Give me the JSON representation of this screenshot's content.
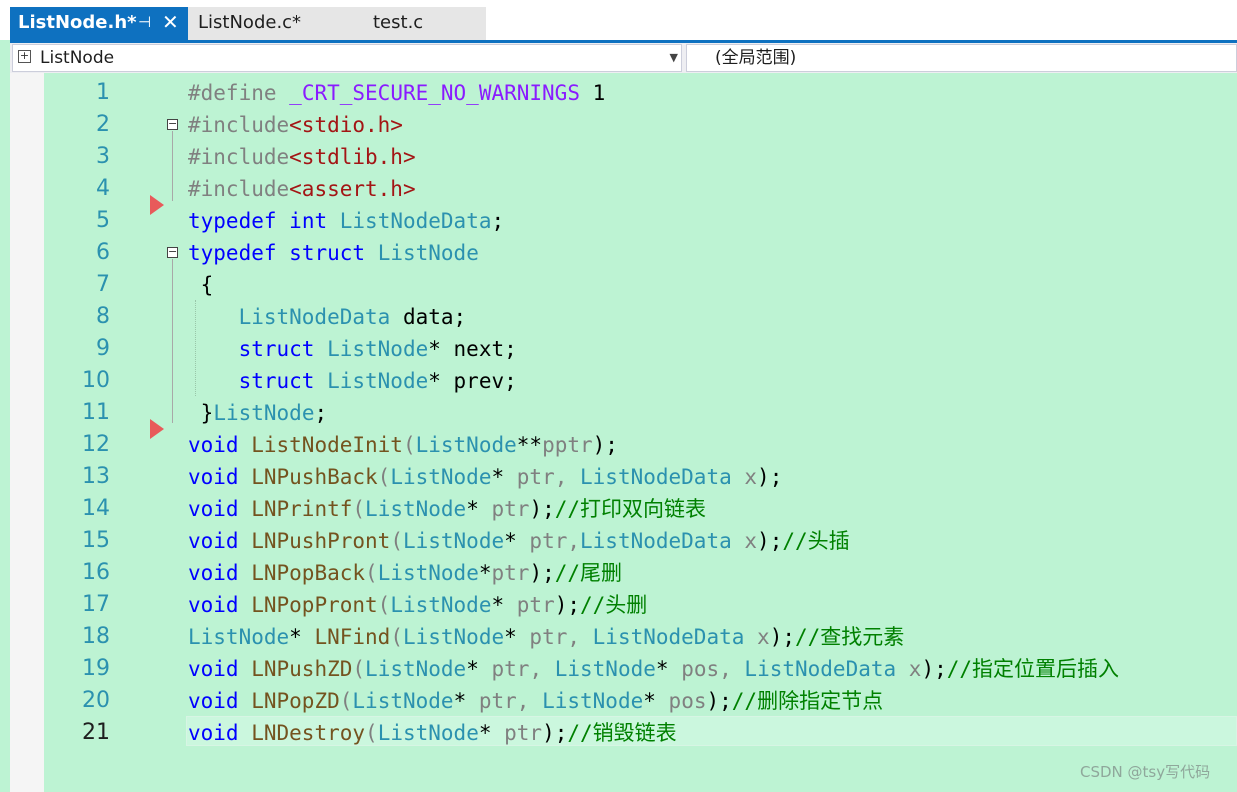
{
  "tabs": [
    {
      "name": "ListNode.h*",
      "active": true
    },
    {
      "name": "ListNode.c*",
      "active": false
    },
    {
      "name": "test.c",
      "active": false
    }
  ],
  "tab_icons": {
    "pin": "⊣",
    "close": "✕"
  },
  "navigation": {
    "class_scope": "ListNode",
    "member_scope": "(全局范围)"
  },
  "line_numbers": [
    "1",
    "2",
    "3",
    "4",
    "5",
    "6",
    "7",
    "8",
    "9",
    "10",
    "11",
    "12",
    "13",
    "14",
    "15",
    "16",
    "17",
    "18",
    "19",
    "20",
    "21"
  ],
  "current_line": 21,
  "code": {
    "l1": {
      "kw": "#define",
      "mac": "_CRT_SECURE_NO_WARNINGS",
      "num": "1"
    },
    "l2": {
      "kw": "#include",
      "str": "<stdio.h>"
    },
    "l3": {
      "kw": "#include",
      "str": "<stdlib.h>"
    },
    "l4": {
      "kw": "#include",
      "str": "<assert.h>"
    },
    "l5": {
      "kw": "typedef",
      "kw2": "int",
      "ty": "ListNodeData",
      "end": ";"
    },
    "l6": {
      "kw": "typedef",
      "kw2": "struct",
      "ty": "ListNode"
    },
    "l7": {
      "brace": "{"
    },
    "l8": {
      "ty": "ListNodeData",
      "name": "data;"
    },
    "l9": {
      "kw": "struct",
      "ty": "ListNode",
      "name": "* next;"
    },
    "l10": {
      "kw": "struct",
      "ty": "ListNode",
      "name": "* prev;"
    },
    "l11": {
      "brace": "}",
      "ty": "ListNode",
      "end": ";"
    },
    "l12": {
      "kw": "void",
      "fn": "ListNodeInit",
      "t1": "ListNode",
      "star": "**",
      "p1": "pptr",
      "end": ");"
    },
    "l13": {
      "kw": "void",
      "fn": "LNPushBack",
      "t1": "ListNode",
      "p1": "ptr",
      "t2": "ListNodeData",
      "p2": "x",
      "end": ");"
    },
    "l14": {
      "kw": "void",
      "fn": "LNPrintf",
      "t1": "ListNode",
      "p1": "ptr",
      "end": ");",
      "cm": "//打印双向链表"
    },
    "l15": {
      "kw": "void",
      "fn": "LNPushPront",
      "t1": "ListNode",
      "p1": "ptr",
      "t2": "ListNodeData",
      "p2": "x",
      "end": ");",
      "cm": "//头插"
    },
    "l16": {
      "kw": "void",
      "fn": "LNPopBack",
      "t1": "ListNode",
      "p1": "ptr",
      "end": ");",
      "cm": "//尾删"
    },
    "l17": {
      "kw": "void",
      "fn": "LNPopPront",
      "t1": "ListNode",
      "p1": "ptr",
      "end": ");",
      "cm": "//头删"
    },
    "l18": {
      "ty": "ListNode",
      "fn": "LNFind",
      "t1": "ListNode",
      "p1": "ptr",
      "t2": "ListNodeData",
      "p2": "x",
      "end": ");",
      "cm": "//查找元素"
    },
    "l19": {
      "kw": "void",
      "fn": "LNPushZD",
      "t1": "ListNode",
      "p1": "ptr",
      "t2": "ListNode",
      "p2": "pos",
      "t3": "ListNodeData",
      "p3": "x",
      "end": ");",
      "cm": "//指定位置后插入"
    },
    "l20": {
      "kw": "void",
      "fn": "LNPopZD",
      "t1": "ListNode",
      "p1": "ptr",
      "t2": "ListNode",
      "p2": "pos",
      "end": ");",
      "cm": "//删除指定节点"
    },
    "l21": {
      "kw": "void",
      "fn": "LNDestroy",
      "t1": "ListNode",
      "p1": "ptr",
      "end": ");",
      "cm": "//销毁链表"
    }
  },
  "watermark": "CSDN @tsy写代码"
}
